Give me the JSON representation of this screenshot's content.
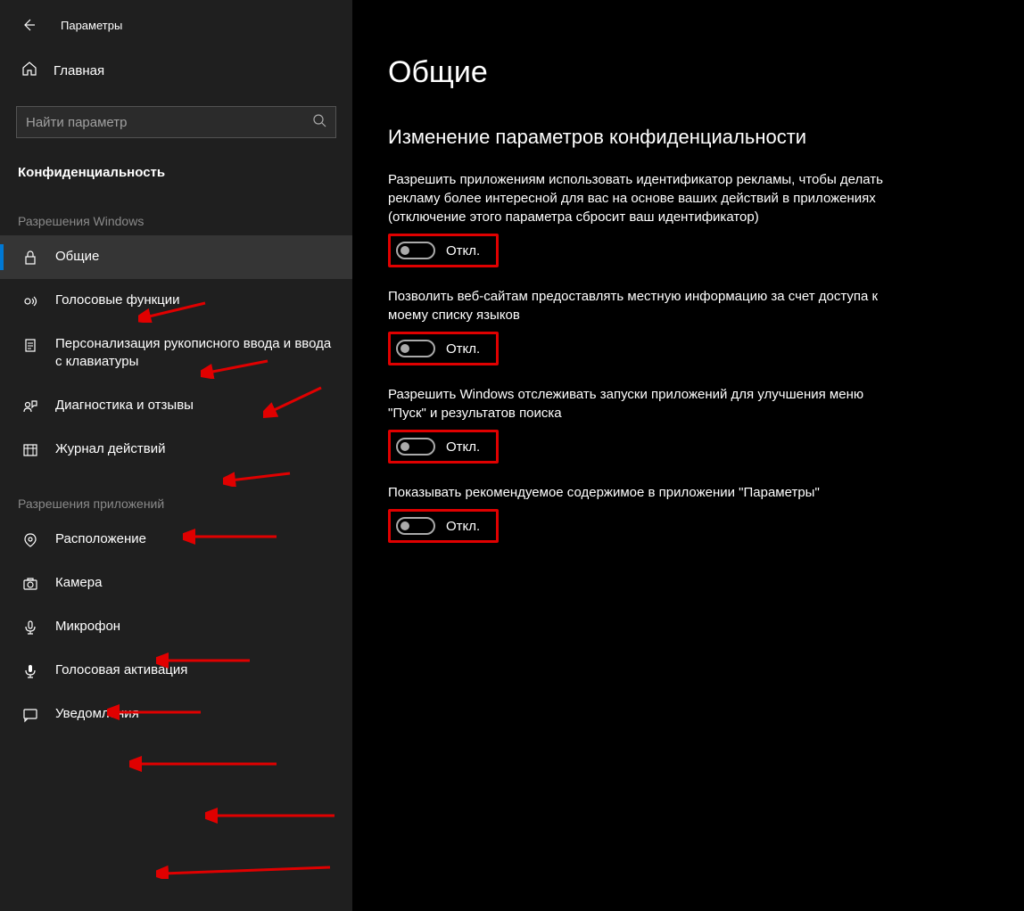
{
  "app": {
    "title": "Параметры"
  },
  "sidebar": {
    "home": "Главная",
    "search_placeholder": "Найти параметр",
    "section": "Конфиденциальность",
    "group1": "Разрешения Windows",
    "group2": "Разрешения приложений",
    "items1": [
      {
        "label": "Общие",
        "selected": true,
        "icon": "lock"
      },
      {
        "label": "Голосовые функции",
        "icon": "voice"
      },
      {
        "label": "Персонализация рукописного ввода и ввода с клавиатуры",
        "icon": "clipboard"
      },
      {
        "label": "Диагностика и отзывы",
        "icon": "feedback"
      },
      {
        "label": "Журнал действий",
        "icon": "history"
      }
    ],
    "items2": [
      {
        "label": "Расположение",
        "icon": "location"
      },
      {
        "label": "Камера",
        "icon": "camera"
      },
      {
        "label": "Микрофон",
        "icon": "microphone"
      },
      {
        "label": "Голосовая активация",
        "icon": "voice-activate"
      },
      {
        "label": "Уведомления",
        "icon": "notification"
      }
    ]
  },
  "content": {
    "heading": "Общие",
    "subheading": "Изменение параметров конфиденциальности",
    "off_label": "Откл.",
    "settings": [
      {
        "desc": "Разрешить приложениям использовать идентификатор рекламы, чтобы делать рекламу более интересной для вас на основе ваших действий в приложениях (отключение этого параметра сбросит ваш идентификатор)",
        "state": "off"
      },
      {
        "desc": "Позволить веб-сайтам предоставлять местную информацию за счет доступа к моему списку языков",
        "state": "off"
      },
      {
        "desc": "Разрешить Windows отслеживать запуски приложений для улучшения меню \"Пуск\" и результатов поиска",
        "state": "off"
      },
      {
        "desc": "Показывать рекомендуемое содержимое в приложении \"Параметры\"",
        "state": "off"
      }
    ]
  },
  "annotations": {
    "highlight_color": "#e00000",
    "arrows_count": 10
  }
}
